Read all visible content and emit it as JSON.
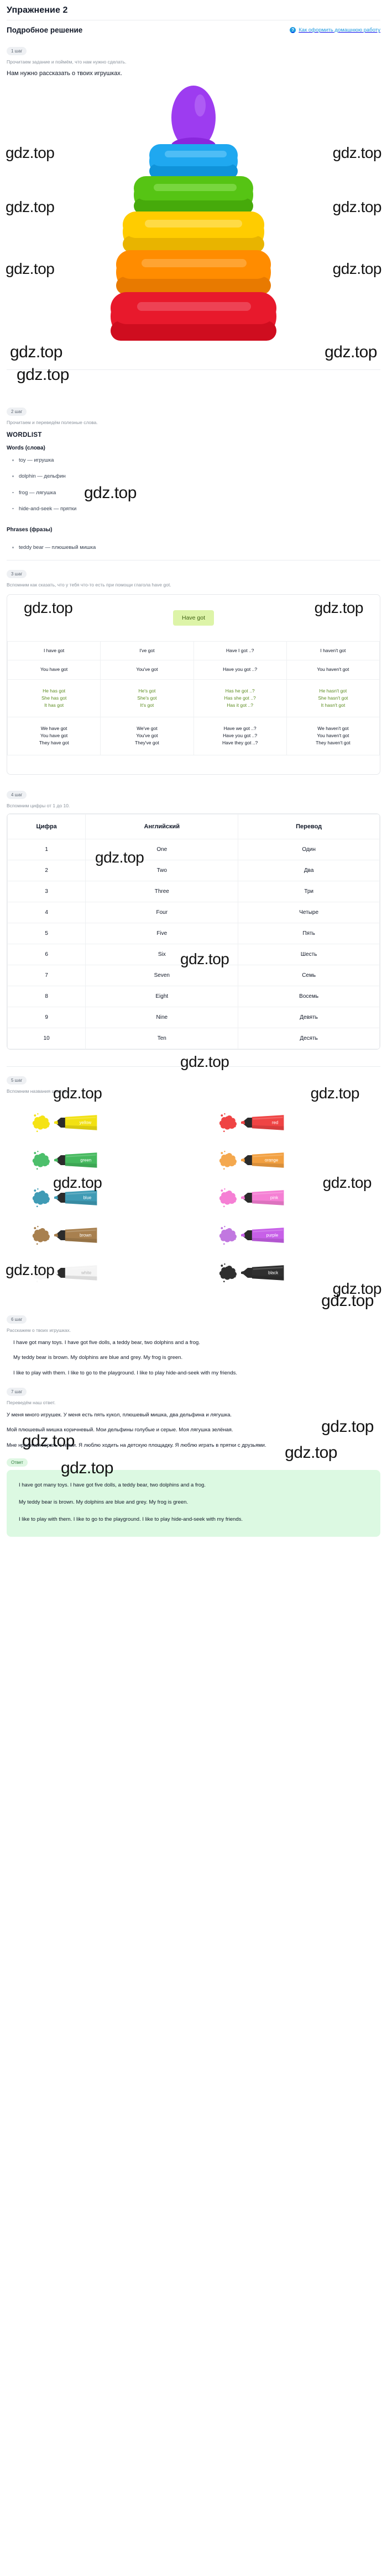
{
  "header": {
    "exercise_title": "Упражнение 2",
    "solution_title": "Подробное решение",
    "help_icon": "question-mark-icon",
    "help_link": "Как оформить домашнюю работу"
  },
  "steps": {
    "step1": {
      "badge": "1 шаг",
      "note": "Прочитаем задание и поймём, что нам нужно сделать.",
      "lead": "Нам нужно рассказать о твоих игрушках."
    },
    "step2": {
      "badge": "2 шаг",
      "note": "Прочитаем и переведём полезные слова.",
      "wordlist_title": "WORDLIST",
      "words_heading": "Words (слова)",
      "words": [
        "toy — игрушка",
        "dolphin — дельфин",
        "frog — лягушка",
        "hide-and-seek — прятки"
      ],
      "phrases_heading": "Phrases (фразы)",
      "phrases": [
        "teddy bear — плюшевый мишка"
      ]
    },
    "step3": {
      "badge": "3 шаг",
      "note": "Вспомним как сказать, что у тебя что-то есть при помощи глагола have got.",
      "chip": "Have got"
    },
    "step4": {
      "badge": "4 шаг",
      "note": "Вспомним цифры от 1 до 10."
    },
    "step5": {
      "badge": "5 шаг",
      "note": "Вспомним названия цветов."
    },
    "step6": {
      "badge": "6 шаг",
      "note": "Расскажем о твоих игрушках.",
      "paragraphs": [
        "I have got many toys. I have got five dolls, a teddy bear, two dolphins and a frog.",
        "My teddy bear is brown. My dolphins are blue and grey. My frog is green.",
        "I like to play with them. I like to go to the playground. I like to play hide-and-seek with my friends."
      ]
    },
    "step7": {
      "badge": "7 шаг",
      "note": "Переведём наш ответ.",
      "paragraphs": [
        "У меня много игрушек. У меня есть пять кукол, плюшевый мишка, два дельфина и лягушка.",
        "Мой плюшевый мишка коричневый. Мои дельфины голубые и серые. Моя лягушка зелёная.",
        "Мне нравится играть с ними. Я люблю ходить на детскую площадку. Я люблю играть в прятки с друзьями."
      ]
    }
  },
  "have_got_table": {
    "rows": [
      {
        "green": false,
        "cells": [
          "I have got",
          "I've got",
          "Have I got ..?",
          "I haven't got"
        ]
      },
      {
        "green": false,
        "cells": [
          "You have got",
          "You've got",
          "Have you got ..?",
          "You haven't got"
        ]
      },
      {
        "green": true,
        "cells": [
          "He has got\nShe has got\nIt has got",
          "He's got\nShe's got\nIt's got",
          "Has he got ..?\nHas she got ..?\nHas it got ..?",
          "He hasn't got\nShe hasn't got\nIt hasn't got"
        ]
      },
      {
        "green": false,
        "cells": [
          "We have got\nYou have got\nThey have got",
          "We've got\nYou've got\nThey've got",
          "Have we got ..?\nHave you got ..?\nHave they got ..?",
          "We haven't got\nYou haven't got\nThey haven't got"
        ]
      }
    ]
  },
  "numbers_table": {
    "headers": [
      "Цифра",
      "Английский",
      "Перевод"
    ],
    "rows": [
      [
        "1",
        "One",
        "Один"
      ],
      [
        "2",
        "Two",
        "Два"
      ],
      [
        "3",
        "Three",
        "Три"
      ],
      [
        "4",
        "Four",
        "Четыре"
      ],
      [
        "5",
        "Five",
        "Пять"
      ],
      [
        "6",
        "Six",
        "Шесть"
      ],
      [
        "7",
        "Seven",
        "Семь"
      ],
      [
        "8",
        "Eight",
        "Восемь"
      ],
      [
        "9",
        "Nine",
        "Девять"
      ],
      [
        "10",
        "Ten",
        "Десять"
      ]
    ]
  },
  "colors": [
    {
      "label": "yellow",
      "hex": "#f2e112",
      "splat": "#f5e315",
      "text": "#ffffff"
    },
    {
      "label": "red",
      "hex": "#ef4444",
      "splat": "#ef4444",
      "text": "#ffffff"
    },
    {
      "label": "green",
      "hex": "#45b95e",
      "splat": "#4cbf6b",
      "text": "#ffffff"
    },
    {
      "label": "orange",
      "hex": "#f2a041",
      "splat": "#f4a84e",
      "text": "#ffffff"
    },
    {
      "label": "blue",
      "hex": "#3f9bb5",
      "splat": "#3f9bb5",
      "text": "#ffffff"
    },
    {
      "label": "pink",
      "hex": "#f57fd4",
      "splat": "#f57fd4",
      "text": "#ffffff"
    },
    {
      "label": "brown",
      "hex": "#a8804f",
      "splat": "#a8804f",
      "text": "#ffffff"
    },
    {
      "label": "purple",
      "hex": "#c760e8",
      "splat": "#c178e0",
      "text": "#ffffff"
    },
    {
      "label": "white",
      "hex": "#f4f4f4",
      "splat": "#f7f7f7",
      "text": "#b5b5b5"
    },
    {
      "label": "black",
      "hex": "#2f2f2f",
      "splat": "#2f2f2f",
      "text": "#ffffff"
    }
  ],
  "answer": {
    "badge": "Ответ",
    "paragraphs": [
      "I have got many toys. I have got five dolls, a teddy bear, two dolphins and a frog.",
      "My teddy bear is brown. My dolphins are blue and grey. My frog is green.",
      "I like to play with them. I like to go to the playground. I like to play hide-and-seek with my friends."
    ]
  },
  "watermark": {
    "text": "gdz.top"
  },
  "toy": {
    "name": "pyramid-stacking-toy",
    "rings": [
      {
        "color": "#9d3cf0",
        "shape": "dome"
      },
      {
        "color": "#1fa8f0",
        "shape": "ring"
      },
      {
        "color": "#56c414",
        "shape": "ring"
      },
      {
        "color": "#ffcc00",
        "shape": "ring"
      },
      {
        "color": "#ff8c00",
        "shape": "ring"
      },
      {
        "color": "#e8192c",
        "shape": "ring"
      }
    ]
  }
}
